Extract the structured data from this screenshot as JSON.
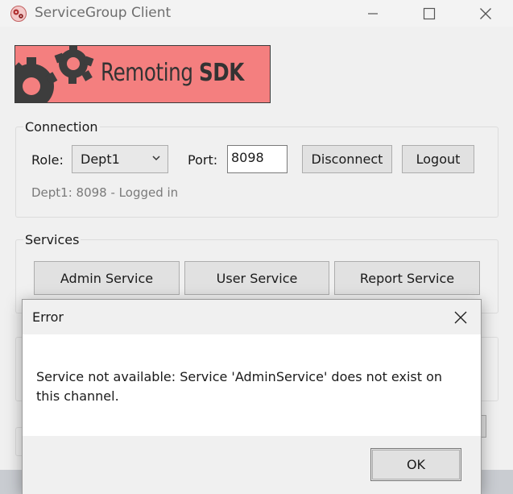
{
  "window": {
    "title": "ServiceGroup Client",
    "minimize_glyph": "—",
    "maximize_glyph": "☐",
    "close_glyph": "✕"
  },
  "banner": {
    "text_regular": "Remoting ",
    "text_bold": "SDK",
    "color": "#f47f7f"
  },
  "connection": {
    "group_label": "Connection",
    "role_label": "Role:",
    "role_value": "Dept1",
    "port_label": "Port:",
    "port_value": "8098",
    "disconnect_label": "Disconnect",
    "logout_label": "Logout",
    "status_text": "Dept1: 8098 - Logged in"
  },
  "services": {
    "group_label": "Services",
    "admin_label": "Admin Service",
    "user_label": "User Service",
    "report_label": "Report Service"
  },
  "dialog": {
    "title": "Error",
    "message": "Service not available: Service 'AdminService' does not exist on this channel.",
    "ok_label": "OK"
  },
  "icons": {
    "app": "gears-icon",
    "banner": "gear-icon",
    "dropdown": "chevron-down-icon",
    "close": "close-icon"
  }
}
